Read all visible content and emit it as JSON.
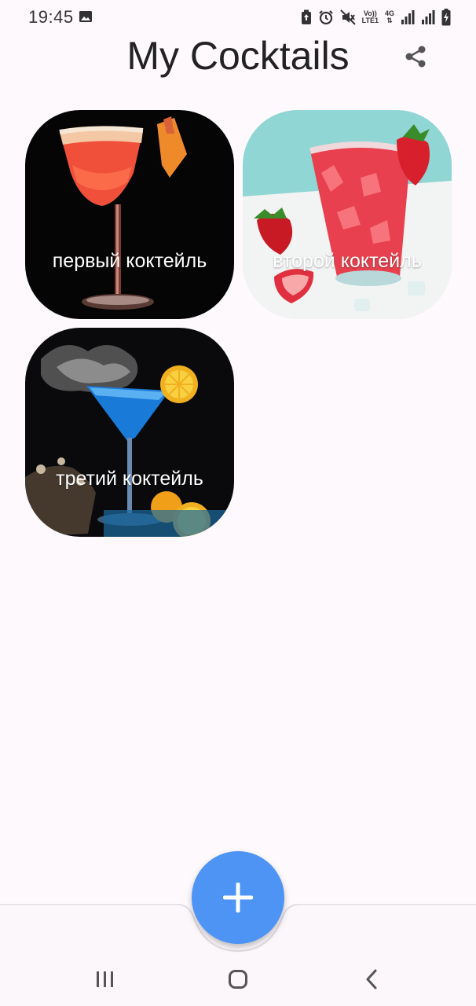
{
  "status_bar": {
    "time": "19:45",
    "icons": [
      "image-icon",
      "battery-saver-icon",
      "alarm-icon",
      "mute-icon",
      "volte-icon",
      "4g-icon",
      "signal-icon",
      "signal-icon",
      "battery-icon"
    ],
    "volte_label_top": "Vo))",
    "volte_label_bottom": "LTE1",
    "network_label": "4G"
  },
  "app_bar": {
    "title": "My Cocktails",
    "share_icon": "share-icon"
  },
  "cocktails": [
    {
      "name": "первый коктейль",
      "image": "red-margarita-photo"
    },
    {
      "name": "второй коктейль",
      "image": "strawberry-drink-photo"
    },
    {
      "name": "третий коктейль",
      "image": "blue-martini-photo"
    }
  ],
  "fab": {
    "icon": "plus-icon"
  },
  "system_nav": {
    "recents_icon": "recents-icon",
    "home_icon": "home-icon",
    "back_icon": "back-icon"
  },
  "colors": {
    "background": "#fdf9fc",
    "fab": "#4d94f5",
    "bottom_bar": "#fbf7fa"
  }
}
